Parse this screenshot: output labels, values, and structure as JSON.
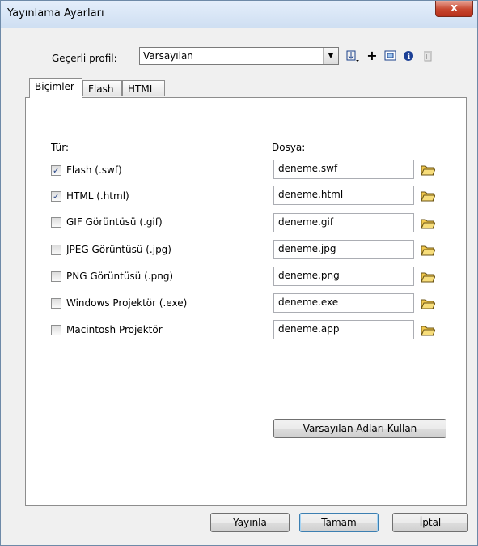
{
  "window": {
    "title": "Yayınlama Ayarları",
    "close_label": "x"
  },
  "profile": {
    "label": "Geçerli profil:",
    "value": "Varsayılan",
    "arrow": "▼"
  },
  "toolbar_icons": [
    {
      "name": "import-export-icon",
      "glyph": "⇩"
    },
    {
      "name": "add-profile-icon",
      "glyph": "+"
    },
    {
      "name": "duplicate-profile-icon",
      "glyph": "⧉"
    },
    {
      "name": "profile-properties-icon",
      "glyph": "i"
    },
    {
      "name": "delete-profile-icon",
      "glyph": "🗑"
    }
  ],
  "tabs": [
    {
      "label": "Biçimler",
      "active": true
    },
    {
      "label": "Flash",
      "active": false
    },
    {
      "label": "HTML",
      "active": false
    }
  ],
  "formats": {
    "type_header": "Tür:",
    "file_header": "Dosya:",
    "items": [
      {
        "label": "Flash  (.swf)",
        "checked": true,
        "file": "deneme.swf"
      },
      {
        "label": "HTML (.html)",
        "checked": true,
        "file": "deneme.html"
      },
      {
        "label": "GIF Görüntüsü (.gif)",
        "checked": false,
        "file": "deneme.gif"
      },
      {
        "label": "JPEG Görüntüsü (.jpg)",
        "checked": false,
        "file": "deneme.jpg"
      },
      {
        "label": "PNG Görüntüsü (.png)",
        "checked": false,
        "file": "deneme.png"
      },
      {
        "label": "Windows Projektör (.exe)",
        "checked": false,
        "file": "deneme.exe"
      },
      {
        "label": "Macintosh Projektör",
        "checked": false,
        "file": "deneme.app"
      }
    ],
    "default_names_button": "Varsayılan Adları Kullan"
  },
  "footer": {
    "publish": "Yayınla",
    "ok": "Tamam",
    "cancel": "İptal"
  },
  "colors": {
    "folder": "#f2c94c",
    "title_bar": "#d7e5f5",
    "close": "#c7472f"
  }
}
